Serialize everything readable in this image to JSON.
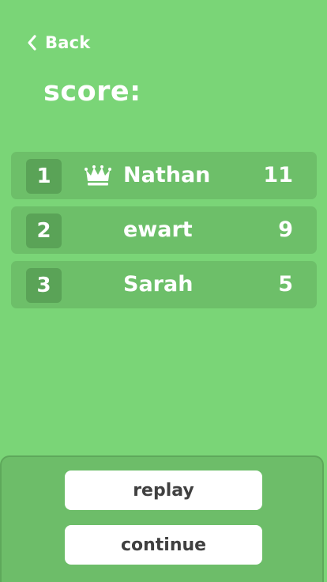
{
  "nav": {
    "back_label": "Back",
    "back_icon": "chevron-left-icon"
  },
  "title": "score:",
  "leaderboard": [
    {
      "rank": "1",
      "name": "Nathan",
      "score": "11",
      "leader_icon": "crown-icon"
    },
    {
      "rank": "2",
      "name": "ewart",
      "score": "9"
    },
    {
      "rank": "3",
      "name": "Sarah",
      "score": "5"
    }
  ],
  "actions": {
    "replay_label": "replay",
    "continue_label": "continue"
  },
  "colors": {
    "background": "#7ad577",
    "row": "#6dbf69",
    "rank_badge": "#5aa357",
    "footer": "#6dbd69",
    "button": "#ffffff",
    "button_text": "#404040"
  }
}
